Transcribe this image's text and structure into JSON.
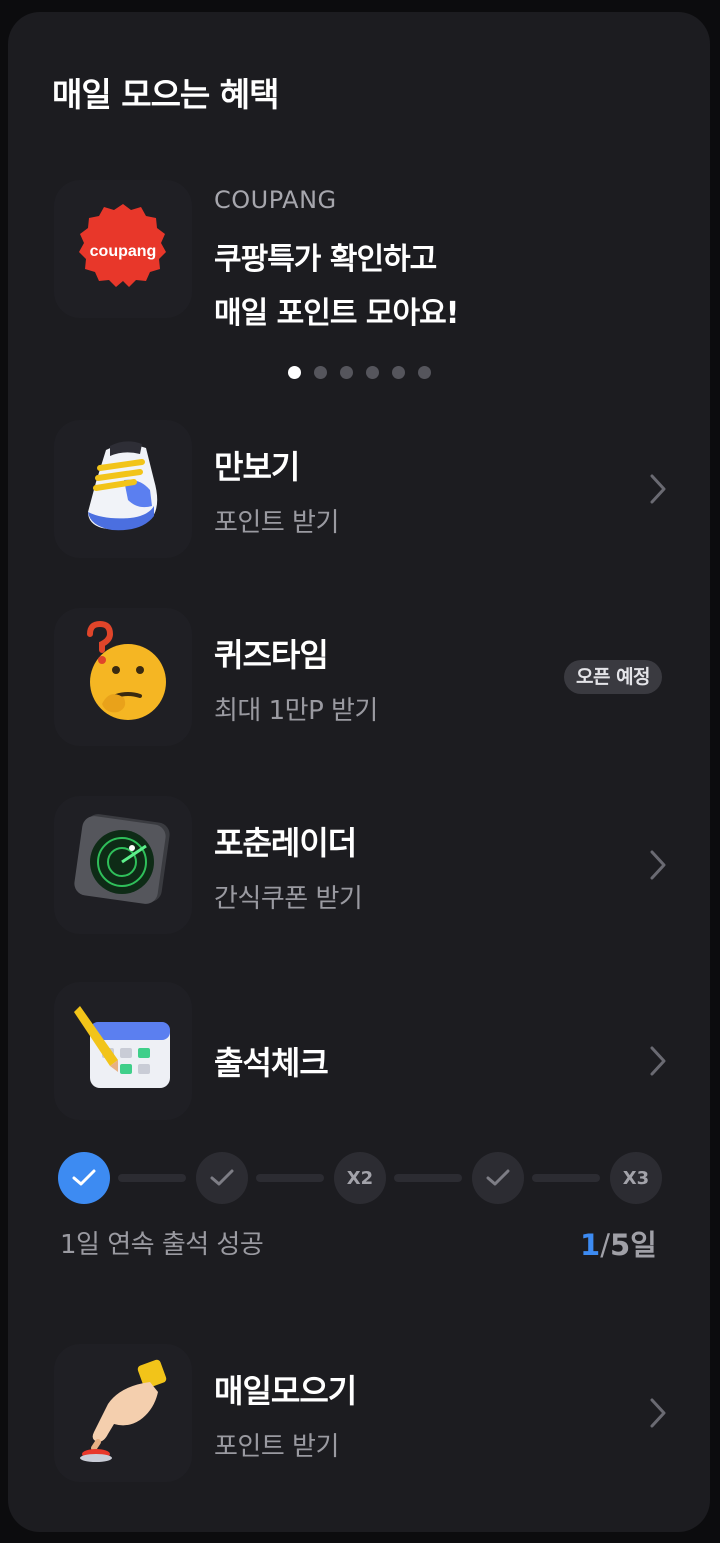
{
  "section": {
    "title": "매일 모으는 혜택"
  },
  "banner": {
    "brand": "COUPANG",
    "logo_text": "coupang",
    "line1": "쿠팡특가 확인하고",
    "line2": "매일 포인트 모아요!",
    "page_count": 6,
    "active_index": 0
  },
  "items": [
    {
      "title": "만보기",
      "subtitle": "포인트 받기",
      "icon": "sneaker-icon"
    },
    {
      "title": "퀴즈타임",
      "subtitle": "최대 1만P 받기",
      "icon": "thinking-face-icon",
      "badge": "오픈 예정"
    },
    {
      "title": "포춘레이더",
      "subtitle": "간식쿠폰 받기",
      "icon": "radar-icon"
    },
    {
      "title": "출석체크",
      "icon": "calendar-icon"
    },
    {
      "title": "매일모으기",
      "subtitle": "포인트 받기",
      "icon": "pointing-hand-icon"
    }
  ],
  "attendance": {
    "steps": [
      {
        "label": "",
        "state": "done",
        "icon": "check-icon"
      },
      {
        "label": "",
        "state": "pending",
        "icon": "check-icon"
      },
      {
        "label": "X2",
        "state": "pending"
      },
      {
        "label": "",
        "state": "pending",
        "icon": "check-icon"
      },
      {
        "label": "X3",
        "state": "pending"
      }
    ],
    "status_text": "1일 연속 출석 성공",
    "current": "1",
    "separator": "/",
    "total": "5일"
  },
  "colors": {
    "background": "#0c0c0e",
    "card": "#1c1c20",
    "accent_blue": "#3d8bf2",
    "coupang_red": "#e8372a"
  }
}
